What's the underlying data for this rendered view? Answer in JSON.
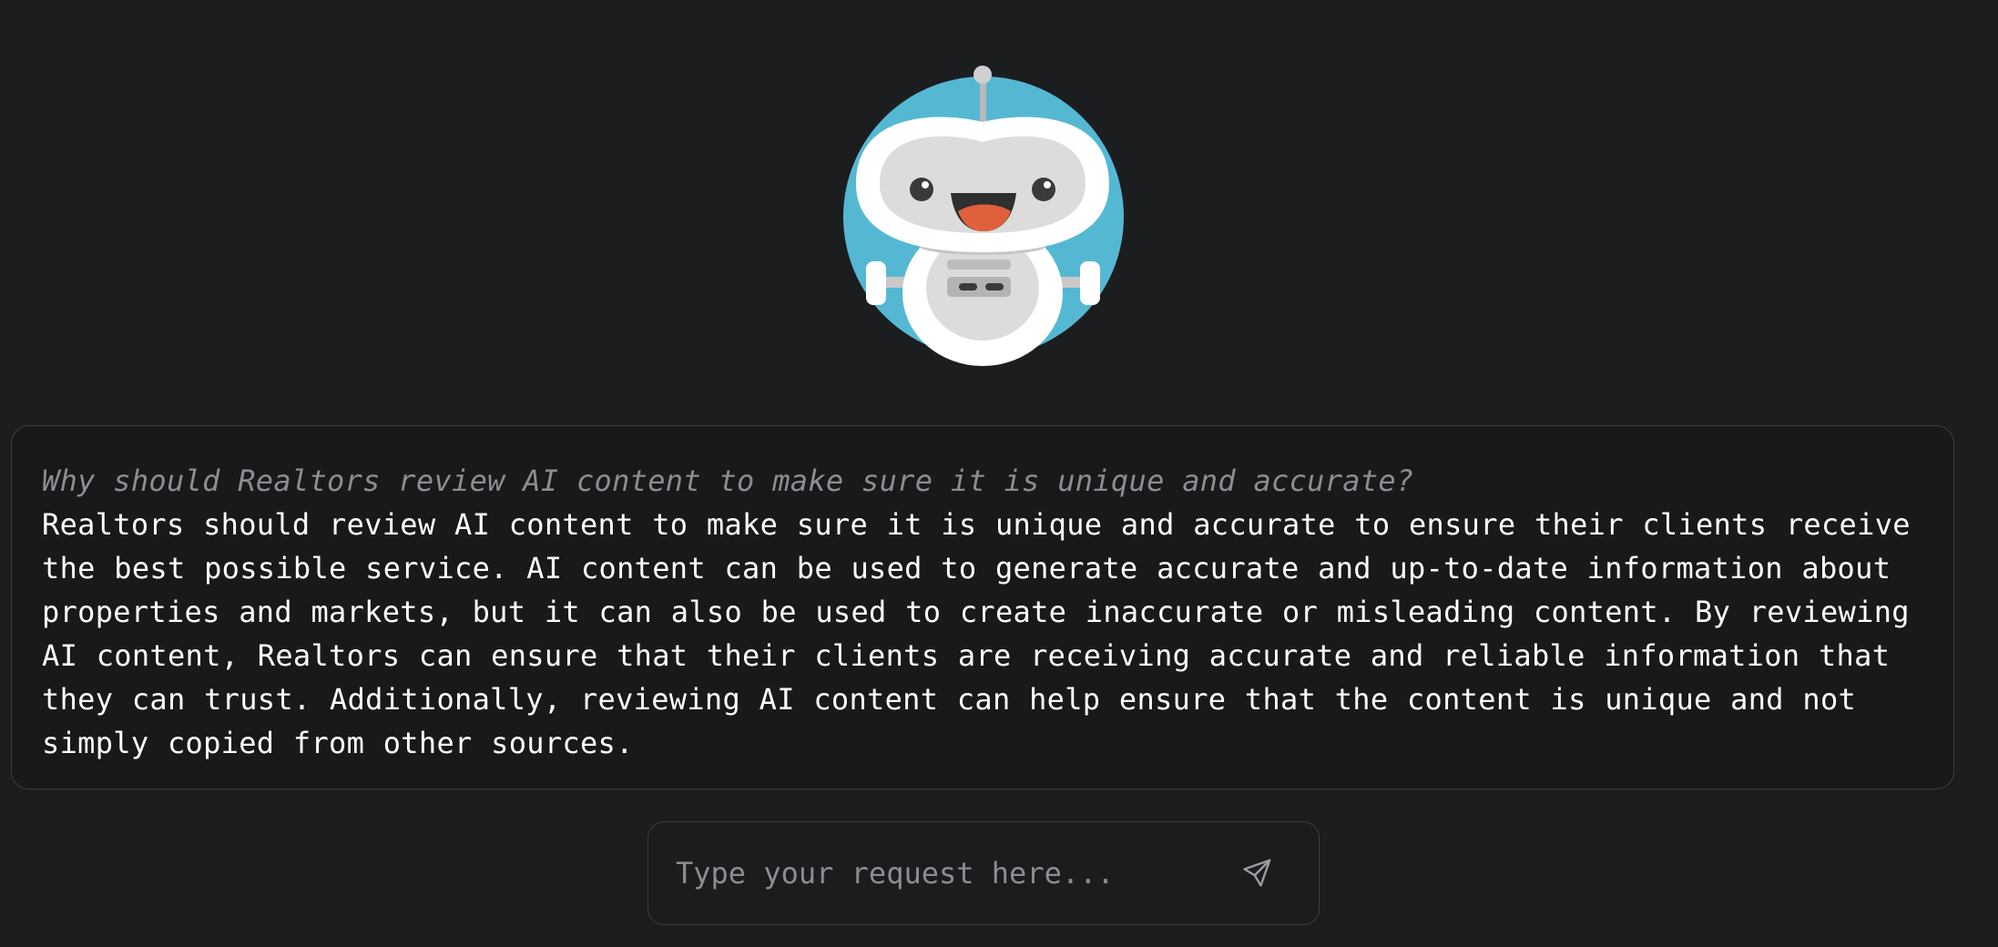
{
  "chat": {
    "question": "Why should Realtors review AI content to make sure it is unique and accurate?",
    "answer": "Realtors should review AI content to make sure it is unique and accurate to ensure their clients receive the best possible service. AI content can be used to generate accurate and up-to-date information about properties and markets, but it can also be used to create inaccurate or misleading content. By reviewing AI content, Realtors can ensure that their clients are receiving accurate and reliable information that they can trust. Additionally, reviewing AI content can help ensure that the content is unique and not simply copied from other sources."
  },
  "input": {
    "placeholder": "Type your request here...",
    "value": ""
  },
  "icons": {
    "avatar": "robot-avatar-icon",
    "send": "send-icon"
  },
  "colors": {
    "background": "#1c1d1f",
    "card": "#18191a",
    "border": "#3a3c40",
    "muted_text": "#8b8d93",
    "avatar_bg": "#55b8d3",
    "robot_mouth": "#e0603b"
  }
}
